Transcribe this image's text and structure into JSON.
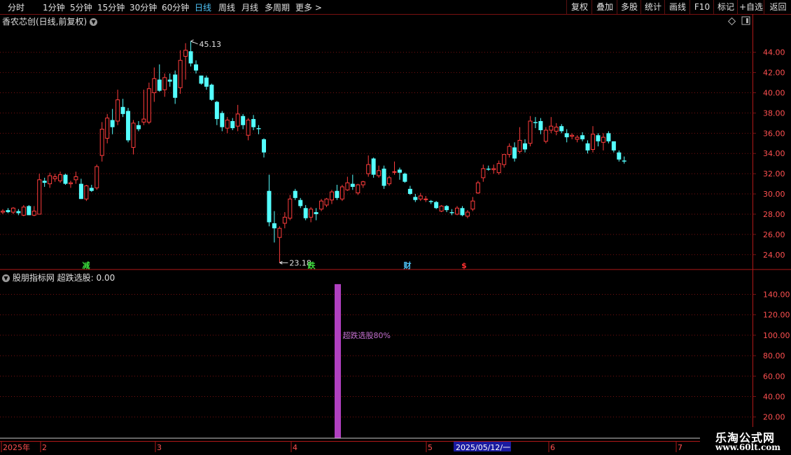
{
  "toolbar": {
    "periods": [
      "分时",
      "1分钟",
      "5分钟",
      "15分钟",
      "30分钟",
      "60分钟",
      "日线",
      "周线",
      "月线",
      "多周期",
      "更多"
    ],
    "active_period": "日线",
    "more_arrow": ">",
    "right_buttons": [
      "复权",
      "叠加",
      "多股",
      "统计",
      "画线",
      "F10",
      "标记",
      "+自选",
      "返回"
    ]
  },
  "stock": {
    "title": "香农芯创(日线,前复权)",
    "high_label": "45.13",
    "low_label": "23.18"
  },
  "price_axis": {
    "ticks": [
      "44.00",
      "42.00",
      "40.00",
      "38.00",
      "36.00",
      "34.00",
      "32.00",
      "30.00",
      "28.00",
      "26.00",
      "24.00"
    ]
  },
  "markers": [
    {
      "text": "减",
      "color": "#3cdc3c"
    },
    {
      "text": "跌",
      "color": "#3cdc3c"
    },
    {
      "text": "财",
      "color": "#4fc3f7"
    },
    {
      "text": "$",
      "color": "#ff3030"
    }
  ],
  "indicator": {
    "title": "股朋指标网 超跌选股: 0.00",
    "label": "超跌选股80%",
    "bar_value": 150,
    "bar_color": "#b040c0",
    "axis_ticks": [
      "140.00",
      "120.00",
      "100.00",
      "80.00",
      "60.00",
      "40.00",
      "20.00"
    ]
  },
  "time_axis": {
    "labels": [
      "2025年",
      "2",
      "3",
      "4",
      "5",
      "6",
      "7"
    ],
    "cursor_date": "2025/05/12/一"
  },
  "colors": {
    "up": "#ff3c3c",
    "down": "#54ffff",
    "grid": "#7a1010",
    "axis_text": "#ff5050"
  },
  "logo": {
    "main": "乐淘公式网",
    "sub": "www.60lt.com"
  },
  "chart_data": {
    "type": "candlestick",
    "ylim": [
      22.6,
      46.4
    ],
    "x_months": [
      "2025年",
      "2",
      "3",
      "4",
      "5",
      "6",
      "7"
    ],
    "candles": [
      {
        "o": 28.2,
        "h": 28.5,
        "l": 28.0,
        "c": 28.3
      },
      {
        "o": 28.4,
        "h": 28.6,
        "l": 28.1,
        "c": 28.2
      },
      {
        "o": 28.2,
        "h": 28.7,
        "l": 28.0,
        "c": 28.6
      },
      {
        "o": 28.3,
        "h": 28.5,
        "l": 27.9,
        "c": 28.1
      },
      {
        "o": 27.9,
        "h": 28.9,
        "l": 27.8,
        "c": 28.7
      },
      {
        "o": 28.8,
        "h": 28.9,
        "l": 27.9,
        "c": 27.9
      },
      {
        "o": 27.9,
        "h": 28.8,
        "l": 27.8,
        "c": 28.3
      },
      {
        "o": 28.0,
        "h": 32.0,
        "l": 28.0,
        "c": 31.4
      },
      {
        "o": 31.3,
        "h": 31.6,
        "l": 30.7,
        "c": 31.1
      },
      {
        "o": 31.0,
        "h": 32.1,
        "l": 30.6,
        "c": 31.8
      },
      {
        "o": 31.5,
        "h": 32.0,
        "l": 31.2,
        "c": 31.7
      },
      {
        "o": 31.3,
        "h": 32.2,
        "l": 31.1,
        "c": 31.9
      },
      {
        "o": 31.9,
        "h": 32.0,
        "l": 30.9,
        "c": 31.0
      },
      {
        "o": 31.0,
        "h": 31.3,
        "l": 30.6,
        "c": 31.1
      },
      {
        "o": 31.4,
        "h": 32.2,
        "l": 31.0,
        "c": 31.7
      },
      {
        "o": 31.0,
        "h": 31.5,
        "l": 29.5,
        "c": 29.5
      },
      {
        "o": 29.5,
        "h": 30.9,
        "l": 29.3,
        "c": 30.8
      },
      {
        "o": 30.6,
        "h": 30.9,
        "l": 30.2,
        "c": 30.3
      },
      {
        "o": 30.6,
        "h": 32.9,
        "l": 30.4,
        "c": 32.7
      },
      {
        "o": 33.8,
        "h": 37.1,
        "l": 33.2,
        "c": 36.4
      },
      {
        "o": 35.5,
        "h": 37.9,
        "l": 35.0,
        "c": 37.5
      },
      {
        "o": 37.3,
        "h": 38.4,
        "l": 35.9,
        "c": 36.6
      },
      {
        "o": 37.2,
        "h": 40.3,
        "l": 36.8,
        "c": 39.3
      },
      {
        "o": 38.6,
        "h": 39.4,
        "l": 37.6,
        "c": 37.9
      },
      {
        "o": 38.2,
        "h": 38.5,
        "l": 35.1,
        "c": 35.3
      },
      {
        "o": 34.6,
        "h": 37.3,
        "l": 33.9,
        "c": 37.0
      },
      {
        "o": 36.8,
        "h": 37.2,
        "l": 36.2,
        "c": 36.4
      },
      {
        "o": 37.1,
        "h": 40.3,
        "l": 36.8,
        "c": 37.4
      },
      {
        "o": 37.1,
        "h": 41.0,
        "l": 36.9,
        "c": 40.4
      },
      {
        "o": 40.0,
        "h": 42.5,
        "l": 39.1,
        "c": 41.4
      },
      {
        "o": 41.3,
        "h": 42.8,
        "l": 40.1,
        "c": 40.2
      },
      {
        "o": 40.3,
        "h": 41.9,
        "l": 39.6,
        "c": 41.5
      },
      {
        "o": 41.3,
        "h": 41.9,
        "l": 40.6,
        "c": 41.1
      },
      {
        "o": 41.8,
        "h": 42.2,
        "l": 38.9,
        "c": 39.5
      },
      {
        "o": 40.5,
        "h": 44.2,
        "l": 39.9,
        "c": 43.2
      },
      {
        "o": 43.6,
        "h": 44.9,
        "l": 41.3,
        "c": 44.2
      },
      {
        "o": 44.1,
        "h": 45.1,
        "l": 42.6,
        "c": 42.9
      },
      {
        "o": 42.8,
        "h": 43.2,
        "l": 41.9,
        "c": 42.2
      },
      {
        "o": 41.7,
        "h": 41.7,
        "l": 40.8,
        "c": 40.9
      },
      {
        "o": 41.5,
        "h": 41.7,
        "l": 40.3,
        "c": 40.6
      },
      {
        "o": 40.8,
        "h": 40.9,
        "l": 39.2,
        "c": 39.3
      },
      {
        "o": 39.1,
        "h": 39.2,
        "l": 36.8,
        "c": 37.4
      },
      {
        "o": 38.0,
        "h": 38.2,
        "l": 36.2,
        "c": 36.6
      },
      {
        "o": 36.5,
        "h": 37.6,
        "l": 36.0,
        "c": 37.3
      },
      {
        "o": 37.2,
        "h": 37.5,
        "l": 36.3,
        "c": 36.5
      },
      {
        "o": 36.7,
        "h": 38.8,
        "l": 36.2,
        "c": 37.9
      },
      {
        "o": 37.7,
        "h": 37.9,
        "l": 36.4,
        "c": 36.8
      },
      {
        "o": 35.8,
        "h": 37.5,
        "l": 35.3,
        "c": 37.3
      },
      {
        "o": 37.4,
        "h": 37.8,
        "l": 36.3,
        "c": 36.6
      },
      {
        "o": 36.5,
        "h": 36.8,
        "l": 35.9,
        "c": 36.4
      },
      {
        "o": 35.4,
        "h": 35.5,
        "l": 33.6,
        "c": 34.1
      },
      {
        "o": 30.3,
        "h": 31.9,
        "l": 26.8,
        "c": 27.2
      },
      {
        "o": 27.1,
        "h": 28.3,
        "l": 25.2,
        "c": 26.6
      },
      {
        "o": 25.7,
        "h": 26.8,
        "l": 23.2,
        "c": 26.6
      },
      {
        "o": 27.1,
        "h": 28.2,
        "l": 26.6,
        "c": 27.7
      },
      {
        "o": 27.6,
        "h": 29.9,
        "l": 27.4,
        "c": 29.5
      },
      {
        "o": 30.3,
        "h": 30.5,
        "l": 29.4,
        "c": 29.6
      },
      {
        "o": 29.4,
        "h": 29.6,
        "l": 28.6,
        "c": 28.8
      },
      {
        "o": 28.6,
        "h": 28.9,
        "l": 27.4,
        "c": 27.6
      },
      {
        "o": 27.7,
        "h": 28.7,
        "l": 27.2,
        "c": 28.5
      },
      {
        "o": 28.2,
        "h": 28.6,
        "l": 27.4,
        "c": 28.0
      },
      {
        "o": 28.5,
        "h": 29.5,
        "l": 28.3,
        "c": 29.3
      },
      {
        "o": 28.9,
        "h": 29.6,
        "l": 28.7,
        "c": 29.5
      },
      {
        "o": 29.4,
        "h": 30.4,
        "l": 29.0,
        "c": 30.2
      },
      {
        "o": 30.3,
        "h": 30.9,
        "l": 29.4,
        "c": 29.6
      },
      {
        "o": 29.5,
        "h": 30.9,
        "l": 29.3,
        "c": 30.7
      },
      {
        "o": 30.4,
        "h": 31.7,
        "l": 30.3,
        "c": 31.1
      },
      {
        "o": 31.0,
        "h": 31.9,
        "l": 30.4,
        "c": 30.7
      },
      {
        "o": 30.1,
        "h": 31.0,
        "l": 29.9,
        "c": 30.9
      },
      {
        "o": 30.9,
        "h": 31.3,
        "l": 30.6,
        "c": 31.2
      },
      {
        "o": 32.0,
        "h": 33.8,
        "l": 31.7,
        "c": 32.9
      },
      {
        "o": 33.5,
        "h": 33.6,
        "l": 31.6,
        "c": 31.9
      },
      {
        "o": 31.8,
        "h": 32.8,
        "l": 31.6,
        "c": 32.3
      },
      {
        "o": 32.5,
        "h": 32.8,
        "l": 30.5,
        "c": 30.8
      },
      {
        "o": 31.0,
        "h": 31.8,
        "l": 30.8,
        "c": 31.6
      },
      {
        "o": 32.2,
        "h": 33.2,
        "l": 31.9,
        "c": 32.2
      },
      {
        "o": 32.4,
        "h": 32.6,
        "l": 31.4,
        "c": 32.1
      },
      {
        "o": 32.0,
        "h": 32.1,
        "l": 31.1,
        "c": 31.2
      },
      {
        "o": 30.5,
        "h": 30.8,
        "l": 29.9,
        "c": 30.0
      },
      {
        "o": 29.7,
        "h": 30.0,
        "l": 29.2,
        "c": 29.4
      },
      {
        "o": 29.5,
        "h": 30.1,
        "l": 29.3,
        "c": 29.8
      },
      {
        "o": 29.5,
        "h": 29.8,
        "l": 29.2,
        "c": 29.5
      },
      {
        "o": 29.3,
        "h": 29.4,
        "l": 29.0,
        "c": 29.2
      },
      {
        "o": 29.2,
        "h": 29.3,
        "l": 28.5,
        "c": 28.6
      },
      {
        "o": 28.3,
        "h": 28.9,
        "l": 28.2,
        "c": 28.8
      },
      {
        "o": 28.8,
        "h": 28.9,
        "l": 28.2,
        "c": 28.4
      },
      {
        "o": 28.2,
        "h": 28.5,
        "l": 27.9,
        "c": 28.1
      },
      {
        "o": 28.0,
        "h": 28.8,
        "l": 27.9,
        "c": 28.6
      },
      {
        "o": 28.6,
        "h": 28.8,
        "l": 27.8,
        "c": 27.9
      },
      {
        "o": 27.8,
        "h": 28.4,
        "l": 27.6,
        "c": 28.2
      },
      {
        "o": 28.5,
        "h": 29.7,
        "l": 28.3,
        "c": 29.3
      },
      {
        "o": 30.1,
        "h": 31.3,
        "l": 30.0,
        "c": 31.1
      },
      {
        "o": 31.6,
        "h": 32.9,
        "l": 31.2,
        "c": 32.5
      },
      {
        "o": 32.5,
        "h": 32.8,
        "l": 32.3,
        "c": 32.4
      },
      {
        "o": 32.4,
        "h": 32.9,
        "l": 32.0,
        "c": 32.5
      },
      {
        "o": 32.1,
        "h": 33.3,
        "l": 31.9,
        "c": 33.0
      },
      {
        "o": 32.9,
        "h": 33.8,
        "l": 32.6,
        "c": 33.9
      },
      {
        "o": 33.9,
        "h": 35.0,
        "l": 33.6,
        "c": 34.7
      },
      {
        "o": 34.6,
        "h": 35.1,
        "l": 33.2,
        "c": 33.5
      },
      {
        "o": 34.2,
        "h": 36.6,
        "l": 34.0,
        "c": 35.3
      },
      {
        "o": 35.0,
        "h": 35.4,
        "l": 34.1,
        "c": 34.4
      },
      {
        "o": 35.0,
        "h": 37.7,
        "l": 34.7,
        "c": 37.2
      },
      {
        "o": 37.1,
        "h": 37.6,
        "l": 36.5,
        "c": 37.0
      },
      {
        "o": 37.2,
        "h": 37.5,
        "l": 35.9,
        "c": 36.3
      },
      {
        "o": 35.2,
        "h": 36.6,
        "l": 35.0,
        "c": 36.3
      },
      {
        "o": 36.3,
        "h": 37.6,
        "l": 36.0,
        "c": 36.7
      },
      {
        "o": 36.2,
        "h": 37.0,
        "l": 35.8,
        "c": 36.6
      },
      {
        "o": 36.7,
        "h": 36.9,
        "l": 36.0,
        "c": 36.2
      },
      {
        "o": 36.0,
        "h": 36.4,
        "l": 35.1,
        "c": 35.6
      },
      {
        "o": 35.7,
        "h": 36.0,
        "l": 35.4,
        "c": 35.8
      },
      {
        "o": 35.4,
        "h": 35.8,
        "l": 35.1,
        "c": 35.6
      },
      {
        "o": 35.8,
        "h": 36.1,
        "l": 35.2,
        "c": 35.4
      },
      {
        "o": 35.0,
        "h": 35.3,
        "l": 34.0,
        "c": 34.3
      },
      {
        "o": 34.4,
        "h": 36.7,
        "l": 34.1,
        "c": 35.9
      },
      {
        "o": 35.8,
        "h": 36.0,
        "l": 34.7,
        "c": 35.2
      },
      {
        "o": 35.1,
        "h": 36.0,
        "l": 34.3,
        "c": 35.6
      },
      {
        "o": 36.0,
        "h": 36.2,
        "l": 35.0,
        "c": 35.2
      },
      {
        "o": 35.2,
        "h": 35.2,
        "l": 34.1,
        "c": 34.3
      },
      {
        "o": 34.1,
        "h": 34.3,
        "l": 33.2,
        "c": 33.4
      },
      {
        "o": 33.3,
        "h": 33.7,
        "l": 33.0,
        "c": 33.2
      }
    ]
  }
}
